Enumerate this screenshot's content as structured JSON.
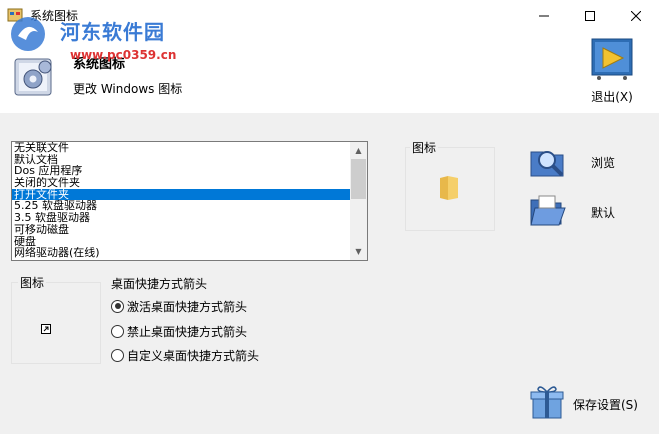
{
  "window": {
    "title": "系统图标",
    "controls": {
      "minimize": "minimize",
      "maximize": "maximize",
      "close": "close"
    }
  },
  "watermark": {
    "line1": "河东软件园",
    "line2": "www.pc0359.cn"
  },
  "header": {
    "title": "系统图标",
    "subtitle": "更改 Windows 图标",
    "exit_label": "退出(X)"
  },
  "list": {
    "selected_index": 4,
    "items": [
      "无关联文件",
      "默认文档",
      "Dos 应用程序",
      "关闭的文件夹",
      "打开文件夹",
      "5.25 软盘驱动器",
      "3.5 软盘驱动器",
      "可移动磁盘",
      "硬盘",
      "网络驱动器(在线)"
    ]
  },
  "icon_panel": {
    "label": "图标"
  },
  "buttons": {
    "browse": "浏览",
    "default": "默认",
    "save": "保存设置(S)"
  },
  "shortcut_icon_panel": {
    "label": "图标"
  },
  "arrow_group": {
    "title": "桌面快捷方式箭头",
    "options": [
      {
        "label": "激活桌面快捷方式箭头",
        "checked": true
      },
      {
        "label": "禁止桌面快捷方式箭头",
        "checked": false
      },
      {
        "label": "自定义桌面快捷方式箭头",
        "checked": false
      }
    ]
  },
  "colors": {
    "selection": "#0078d7",
    "background": "#f0f0f0"
  }
}
